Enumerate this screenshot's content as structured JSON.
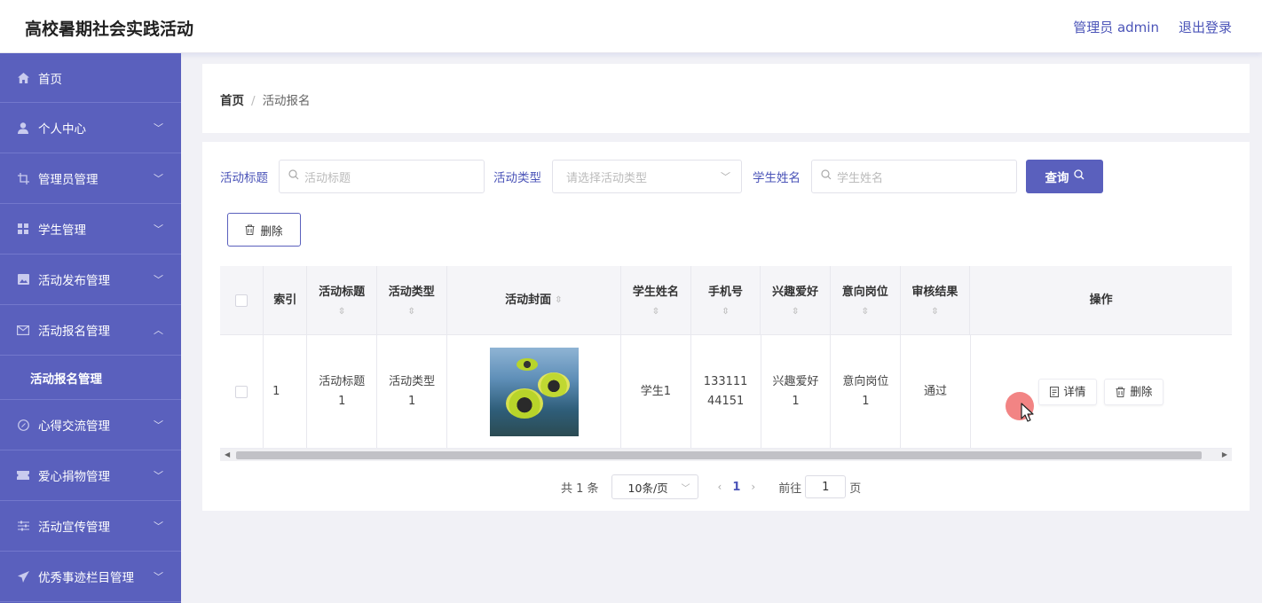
{
  "header": {
    "app_title": "高校暑期社会实践活动",
    "user_label": "管理员 admin",
    "logout_label": "退出登录"
  },
  "sidebar": {
    "items": [
      {
        "label": "首页",
        "icon": "home-icon"
      },
      {
        "label": "个人中心",
        "icon": "user-icon"
      },
      {
        "label": "管理员管理",
        "icon": "crop-icon"
      },
      {
        "label": "学生管理",
        "icon": "grid-icon"
      },
      {
        "label": "活动发布管理",
        "icon": "picture-icon"
      },
      {
        "label": "活动报名管理",
        "icon": "mail-icon"
      },
      {
        "label": "心得交流管理",
        "icon": "compass-icon"
      },
      {
        "label": "爱心捐物管理",
        "icon": "ticket-icon"
      },
      {
        "label": "活动宣传管理",
        "icon": "sliders-icon"
      },
      {
        "label": "优秀事迹栏目管理",
        "icon": "send-icon"
      }
    ],
    "active_sub": "活动报名管理"
  },
  "breadcrumb": {
    "home": "首页",
    "separator": "/",
    "current": "活动报名"
  },
  "filters": {
    "title_label": "活动标题",
    "title_placeholder": "活动标题",
    "type_label": "活动类型",
    "type_placeholder": "请选择活动类型",
    "student_label": "学生姓名",
    "student_placeholder": "学生姓名",
    "query_label": "查询"
  },
  "toolbar": {
    "delete_label": "删除"
  },
  "table": {
    "columns": [
      "索引",
      "活动标题",
      "活动类型",
      "活动封面",
      "学生姓名",
      "手机号",
      "兴趣爱好",
      "意向岗位",
      "审核结果",
      "操作"
    ],
    "rows": [
      {
        "index": "1",
        "title": "活动标题1",
        "type": "活动类型1",
        "student": "学生1",
        "phone": "13311144151",
        "hobby": "兴趣爱好1",
        "position": "意向岗位1",
        "result": "通过",
        "detail_label": "详情",
        "delete_label": "删除"
      }
    ]
  },
  "pagination": {
    "total_text": "共 1 条",
    "page_size": "10条/页",
    "current_page": "1",
    "goto_label": "前往",
    "goto_value": "1",
    "page_suffix": "页"
  },
  "colors": {
    "accent": "#5a60bd",
    "sidebar_bg": "#5a60bd"
  }
}
